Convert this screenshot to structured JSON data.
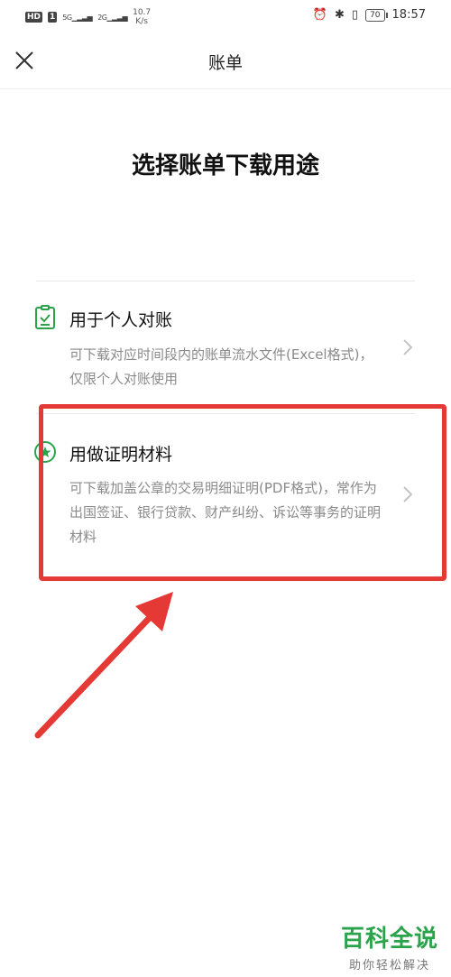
{
  "status_bar": {
    "hd": "HD",
    "sim1": "1",
    "signal1": "5G",
    "signal2": "2G",
    "speed_value": "10.7",
    "speed_unit": "K/s",
    "battery": "70",
    "time": "18:57"
  },
  "nav": {
    "title": "账单"
  },
  "page": {
    "heading": "选择账单下载用途"
  },
  "options": [
    {
      "title": "用于个人对账",
      "desc": "可下载对应时间段内的账单流水文件(Excel格式)，仅限个人对账使用"
    },
    {
      "title": "用做证明材料",
      "desc": "可下载加盖公章的交易明细证明(PDF格式)，常作为出国签证、银行贷款、财产纠纷、诉讼等事务的证明材料"
    }
  ],
  "colors": {
    "brand_green": "#2aa34a",
    "annotation_red": "#e53935"
  },
  "watermark": {
    "title": "百科全说",
    "subtitle": "助你轻松解决"
  }
}
